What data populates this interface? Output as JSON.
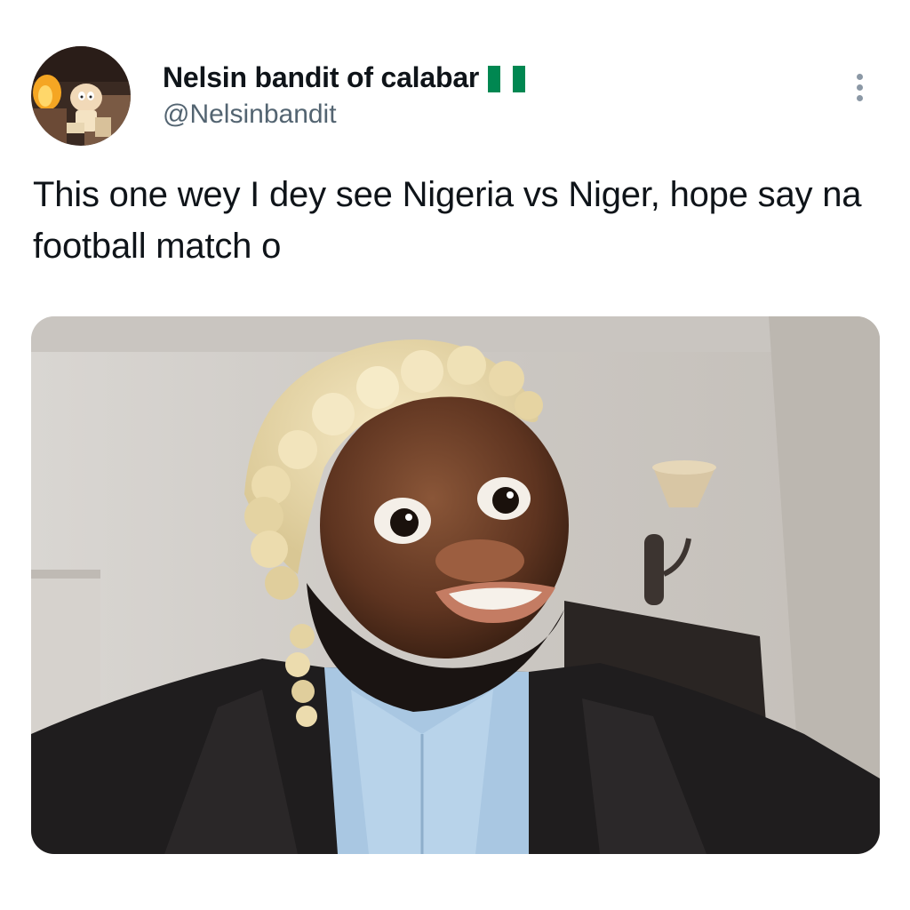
{
  "tweet": {
    "author": {
      "display_name": "Nelsin bandit of calabar",
      "handle": "@Nelsinbandit",
      "flag": "nigeria-flag",
      "avatar_icon": "avatar-cartoon-icon"
    },
    "text": "This one wey I dey see Nigeria vs Niger, hope say na football match o",
    "more_icon": "more-options-icon",
    "media": {
      "kind": "photo"
    }
  },
  "colors": {
    "text_primary": "#0f1419",
    "text_secondary": "#536471",
    "flag_green": "#008751",
    "flag_white": "#ffffff",
    "icon_gray": "#8b98a5"
  }
}
